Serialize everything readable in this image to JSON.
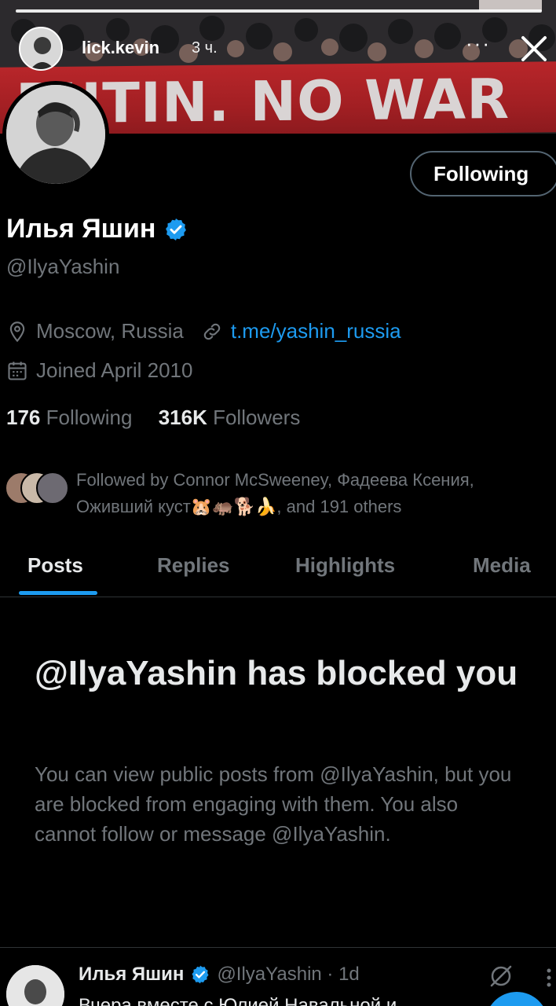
{
  "story": {
    "username": "lick.kevin",
    "time": "3 ч.",
    "more_label": "···"
  },
  "banner": {
    "protest_text": "PUTIN. NO WAR"
  },
  "profile": {
    "following_button": "Following",
    "name": "Илья Яшин",
    "handle": "@IlyaYashin",
    "location": "Moscow, Russia",
    "website": "t.me/yashin_russia",
    "joined": "Joined April 2010",
    "following_count": "176",
    "following_label": "Following",
    "followers_count": "316K",
    "followers_label": "Followers",
    "followed_by": "Followed by Connor McSweeney, Фадеева Ксения, Оживший куст🐹🦛🐕🍌, and 191 others"
  },
  "tabs": [
    {
      "label": "Posts"
    },
    {
      "label": "Replies"
    },
    {
      "label": "Highlights"
    },
    {
      "label": "Media"
    }
  ],
  "blocked": {
    "title": "@IlyaYashin has blocked you",
    "body": "You can view public posts from @IlyaYashin, but you are blocked from engaging with them. You also cannot follow or message @IlyaYashin."
  },
  "post": {
    "author_name": "Илья Яшин",
    "author_handle": "@IlyaYashin · 1d",
    "text_peek": "Вчера вместе с Юлией Навальной и"
  },
  "colors": {
    "accent": "#1d9bf0",
    "background": "#000000",
    "muted_text": "#71767b",
    "banner_red": "#b8262a"
  },
  "icons": [
    "close-icon",
    "verified-badge-icon",
    "location-pin-icon",
    "link-icon",
    "calendar-icon",
    "ghost-icon",
    "more-icon"
  ]
}
